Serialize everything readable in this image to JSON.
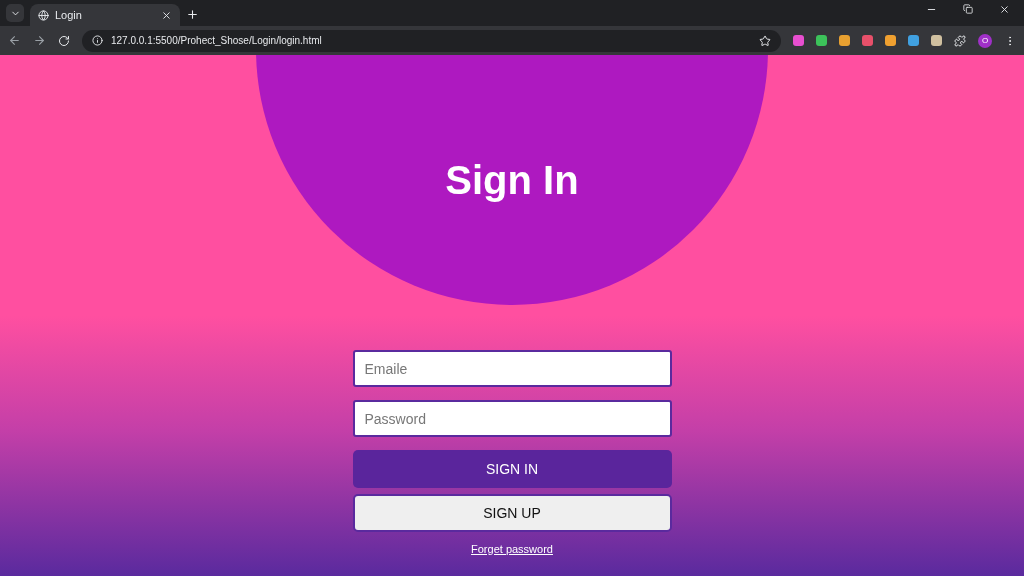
{
  "browser": {
    "tab_title": "Login",
    "url": "127.0.0.1:5500/Prohect_Shose/Login/login.html",
    "profile_initial": "O",
    "extensions": [
      {
        "color": "#e84fd0"
      },
      {
        "color": "#3cc25a"
      },
      {
        "color": "#e8a030"
      },
      {
        "color": "#e8506a"
      },
      {
        "color": "#f0a030"
      },
      {
        "color": "#40a0e0"
      },
      {
        "color": "#d0c0a0"
      }
    ]
  },
  "page": {
    "title": "Sign In",
    "fields": [
      {
        "placeholder": "Emaile"
      },
      {
        "placeholder": "Password"
      }
    ],
    "buttons": [
      {
        "label": "SIGN IN",
        "kind": "primary"
      },
      {
        "label": "SIGN UP",
        "kind": "secondary"
      }
    ],
    "link": "Forget password"
  }
}
